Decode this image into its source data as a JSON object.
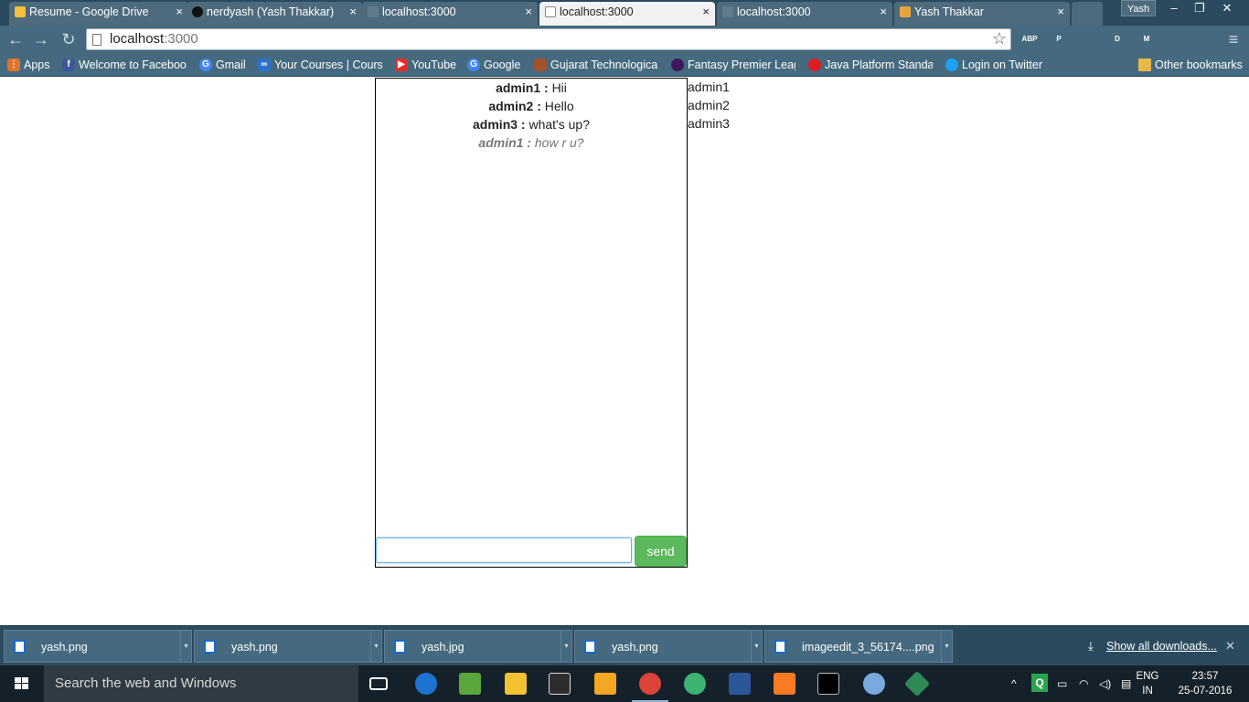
{
  "browser": {
    "tabs": [
      {
        "label": "Resume - Google Drive",
        "active": false
      },
      {
        "label": "nerdyash (Yash Thakkar)",
        "active": false
      },
      {
        "label": "localhost:3000",
        "active": false
      },
      {
        "label": "localhost:3000",
        "active": true
      },
      {
        "label": "localhost:3000",
        "active": false
      },
      {
        "label": "Yash Thakkar",
        "active": false
      }
    ],
    "profile_name": "Yash",
    "window_controls": {
      "minimize": "–",
      "restore": "❐",
      "close": "✕"
    },
    "tab_close": "×",
    "address": {
      "host": "localhost",
      "port": ":3000"
    },
    "extensions": [
      {
        "name": "adblock-plus",
        "label": "ABP",
        "color": "#c70d2c"
      },
      {
        "name": "pinterest",
        "label": "P",
        "color": "#cb2027"
      },
      {
        "name": "cast",
        "label": "",
        "color": "#6f8896"
      },
      {
        "name": "ext-d",
        "label": "D",
        "color": "#2ab24a"
      },
      {
        "name": "gmail-checker",
        "label": "M",
        "color": "#8a9ba5"
      },
      {
        "name": "google-drive",
        "label": "",
        "color": "#f3c13a"
      },
      {
        "name": "ext-card",
        "label": "",
        "color": "#c9d3d9"
      }
    ],
    "bookmarks": [
      {
        "label": "Apps",
        "icon": "apps-icon",
        "color": "#e2732a"
      },
      {
        "label": "Welcome to Faceboo",
        "icon": "facebook-icon",
        "color": "#3b5998"
      },
      {
        "label": "Gmail",
        "icon": "google-icon",
        "color": "#4285f4"
      },
      {
        "label": "Your Courses | Course",
        "icon": "coursera-icon",
        "color": "#2a73cc"
      },
      {
        "label": "YouTube",
        "icon": "youtube-icon",
        "color": "#e52d27"
      },
      {
        "label": "Google",
        "icon": "google-icon",
        "color": "#4285f4"
      },
      {
        "label": "Gujarat Technological",
        "icon": "gtu-icon",
        "color": "#a0522d"
      },
      {
        "label": "Fantasy Premier Leag",
        "icon": "premier-league-icon",
        "color": "#3d195b"
      },
      {
        "label": "Java Platform Standar",
        "icon": "oracle-icon",
        "color": "#e11b22"
      },
      {
        "label": "Login on Twitter",
        "icon": "twitter-icon",
        "color": "#1da1f2"
      }
    ],
    "other_bookmarks": "Other bookmarks"
  },
  "chat": {
    "messages": [
      {
        "user": "admin1",
        "sep": " : ",
        "text": "Hii",
        "typing": false
      },
      {
        "user": "admin2",
        "sep": " : ",
        "text": "Hello",
        "typing": false
      },
      {
        "user": "admin3",
        "sep": " : ",
        "text": "what's up?",
        "typing": false
      },
      {
        "user": "admin1",
        "sep": " : ",
        "text": "how r u?",
        "typing": true
      }
    ],
    "input_value": "",
    "send_label": "send",
    "online_users": [
      "admin1",
      "admin2",
      "admin3"
    ]
  },
  "downloads": {
    "items": [
      "yash.png",
      "yash.png",
      "yash.jpg",
      "yash.png",
      "imageedit_3_56174....png"
    ],
    "show_all": "Show all downloads..."
  },
  "taskbar": {
    "search_placeholder": "Search the web and Windows",
    "language": "ENG",
    "region": "IN",
    "time": "23:57",
    "date": "25-07-2016",
    "apps": [
      {
        "name": "task-view-icon",
        "color": "#15212a",
        "running": false
      },
      {
        "name": "edge-icon",
        "color": "#1e73d2",
        "running": false
      },
      {
        "name": "image-editor-icon",
        "color": "#5aa63c",
        "running": false
      },
      {
        "name": "file-explorer-icon",
        "color": "#f2c230",
        "running": false
      },
      {
        "name": "store-icon",
        "color": "#2d2d2d",
        "running": false
      },
      {
        "name": "app-grid-icon",
        "color": "#f5a623",
        "running": false
      },
      {
        "name": "chrome-icon",
        "color": "#db4437",
        "running": true
      },
      {
        "name": "atom-icon",
        "color": "#3cb371",
        "running": false
      },
      {
        "name": "word-icon",
        "color": "#2b579a",
        "running": false
      },
      {
        "name": "xampp-icon",
        "color": "#fb7a24",
        "running": false
      },
      {
        "name": "terminal-icon",
        "color": "#000000",
        "running": false
      },
      {
        "name": "paint-icon",
        "color": "#7aa9e0",
        "running": false
      },
      {
        "name": "git-icon",
        "color": "#2e8b57",
        "running": false
      }
    ]
  }
}
